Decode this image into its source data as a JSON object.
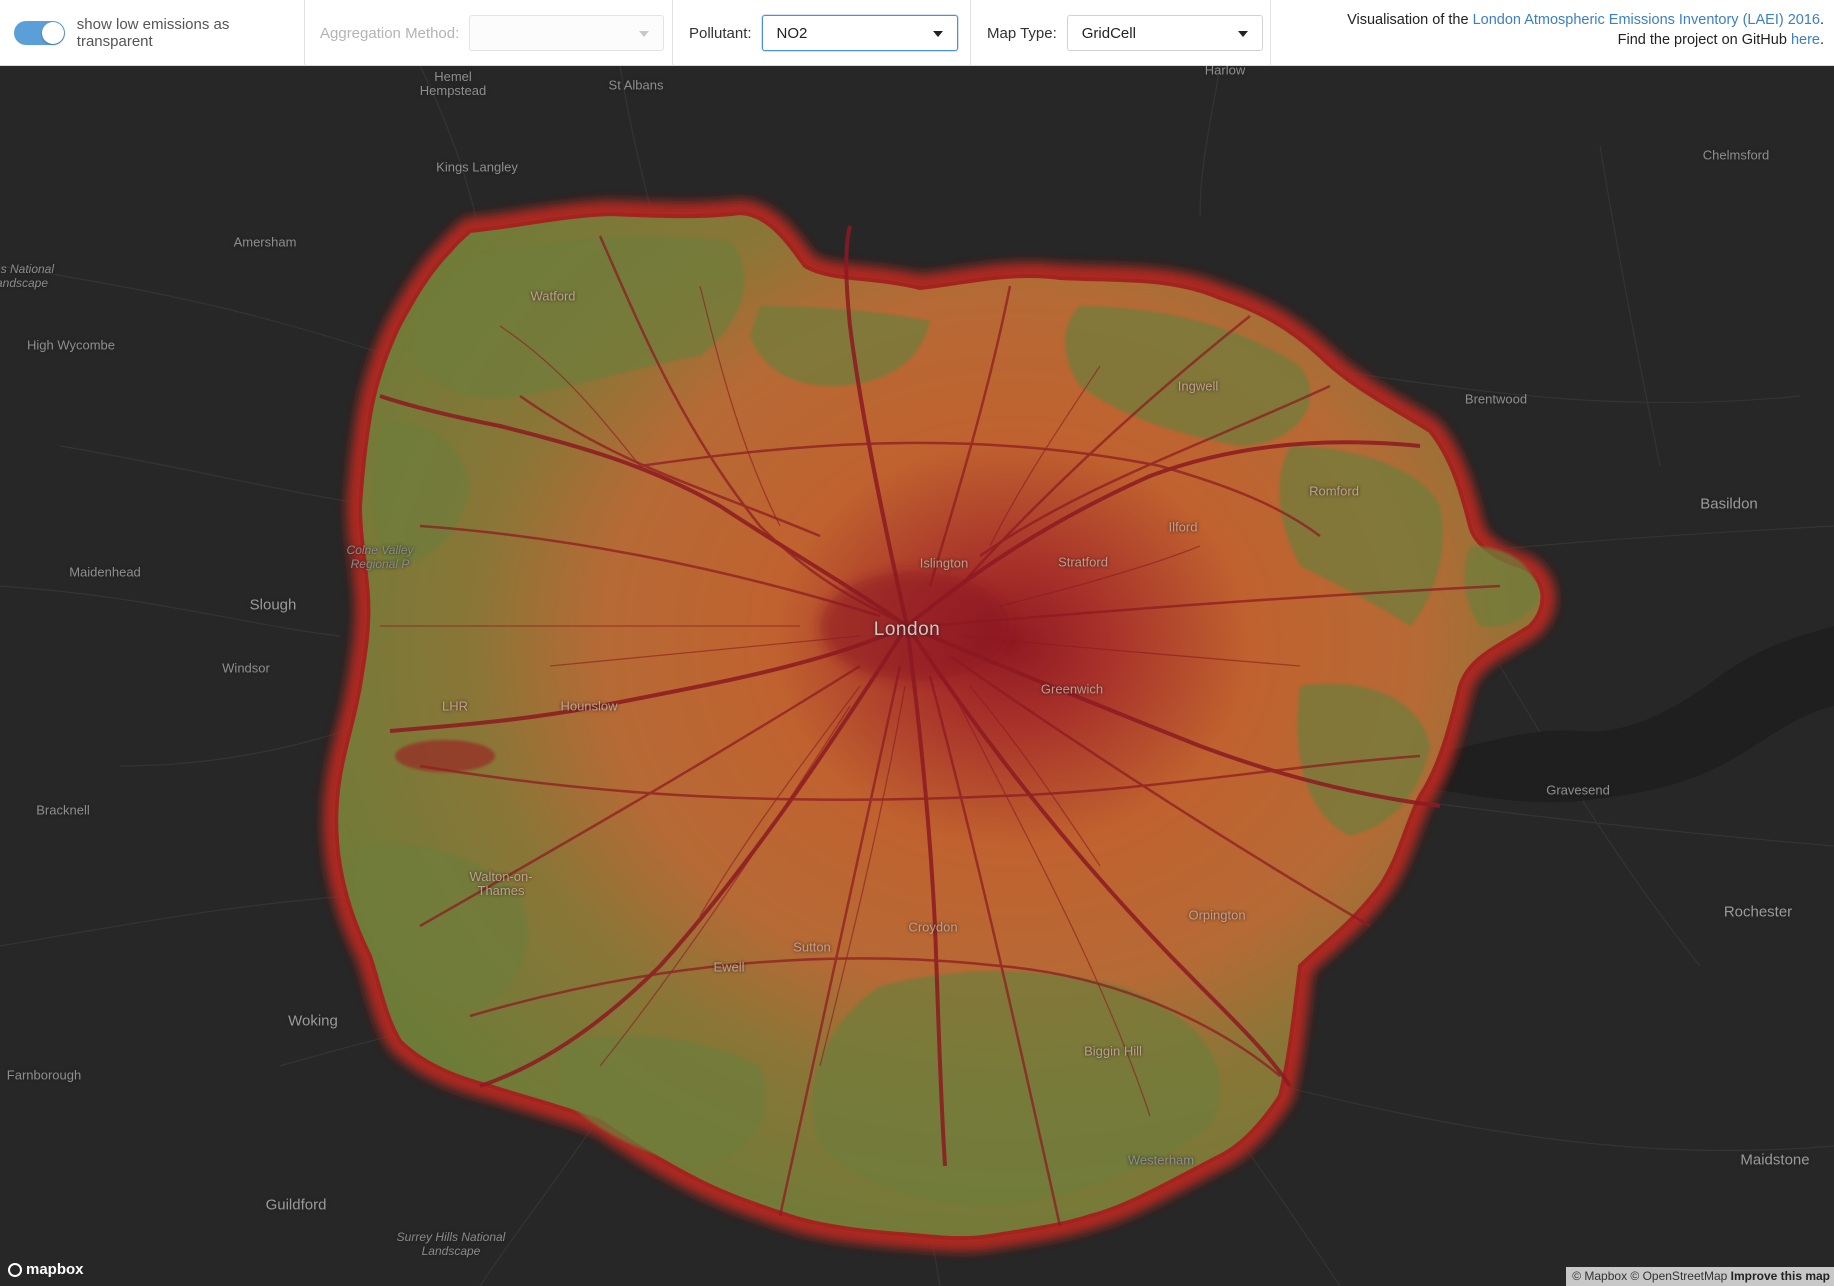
{
  "toolbar": {
    "toggle_label": "show low emissions as transparent",
    "toggle_on": true,
    "aggregation_label": "Aggregation Method:",
    "aggregation_value": "",
    "pollutant_label": "Pollutant:",
    "pollutant_value": "NO2",
    "maptype_label": "Map Type:",
    "maptype_value": "GridCell"
  },
  "info": {
    "line1_prefix": "Visualisation of the ",
    "line1_link": "London Atmospheric Emissions Inventory (LAEI) 2016",
    "line1_suffix": ".",
    "line2_prefix": "Find the project on GitHub ",
    "line2_link": "here",
    "line2_suffix": "."
  },
  "map": {
    "places": [
      {
        "name": "Hemel\nHempstead",
        "type": "small"
      },
      {
        "name": "St Albans",
        "type": "small"
      },
      {
        "name": "Harlow",
        "type": "small"
      },
      {
        "name": "Chelmsford",
        "type": "small"
      },
      {
        "name": "Kings Langley",
        "type": "small"
      },
      {
        "name": "Amersham",
        "type": "small"
      },
      {
        "name": "rns National\nandscape",
        "type": "italic"
      },
      {
        "name": "High Wycombe",
        "type": "small"
      },
      {
        "name": "Brentwood",
        "type": "small"
      },
      {
        "name": "Basildon",
        "type": "small"
      },
      {
        "name": "Maidenhead",
        "type": "small"
      },
      {
        "name": "Colne Valley\nRegional P",
        "type": "italic"
      },
      {
        "name": "Slough",
        "type": "town"
      },
      {
        "name": "Windsor",
        "type": "small"
      },
      {
        "name": "London",
        "type": "city"
      },
      {
        "name": "Islington",
        "type": "over"
      },
      {
        "name": "Stratford",
        "type": "over"
      },
      {
        "name": "Ilford",
        "type": "over"
      },
      {
        "name": "Romford",
        "type": "over"
      },
      {
        "name": "Greenwich",
        "type": "over"
      },
      {
        "name": "Hounslow",
        "type": "over"
      },
      {
        "name": "LHR",
        "type": "over"
      },
      {
        "name": "Gravesend",
        "type": "small"
      },
      {
        "name": "Bracknell",
        "type": "small"
      },
      {
        "name": "Walton-on-\nThames",
        "type": "over"
      },
      {
        "name": "Croydon",
        "type": "over"
      },
      {
        "name": "Sutton",
        "type": "over"
      },
      {
        "name": "Ewell",
        "type": "over"
      },
      {
        "name": "Orpington",
        "type": "over"
      },
      {
        "name": "Rochester",
        "type": "town"
      },
      {
        "name": "Woking",
        "type": "town"
      },
      {
        "name": "Farnborough",
        "type": "small"
      },
      {
        "name": "Biggin Hill",
        "type": "over"
      },
      {
        "name": "Westerham",
        "type": "small"
      },
      {
        "name": "Maidstone",
        "type": "town"
      },
      {
        "name": "Guildford",
        "type": "town"
      },
      {
        "name": "Surrey Hills National\nLandscape",
        "type": "italic"
      },
      {
        "name": "Watford",
        "type": "over"
      },
      {
        "name": "Ingwell",
        "type": "over"
      }
    ],
    "colors": {
      "background": "#272727",
      "low_emission": "#6f7d3a",
      "mid_emission": "#c0622f",
      "high_emission": "#8f1a22"
    }
  },
  "footer": {
    "logo_text": "mapbox",
    "attribution": "© Mapbox © OpenStreetMap",
    "improve": "Improve this map"
  }
}
